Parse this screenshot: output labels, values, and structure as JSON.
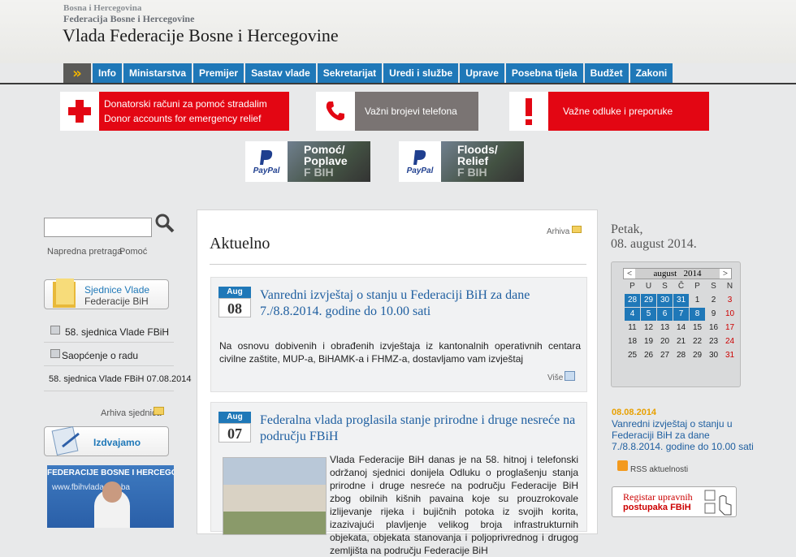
{
  "header": {
    "line1": "Bosna i Hercegovina",
    "line2": "Federacija Bosne i Hercegovine",
    "title": "Vlada Federacije Bosne i Hercegovine"
  },
  "nav": {
    "items": [
      "Info",
      "Ministarstva",
      "Premijer",
      "Sastav vlade",
      "Sekretarijat",
      "Uredi i službe",
      "Uprave",
      "Posebna tijela",
      "Budžet",
      "Zakoni"
    ]
  },
  "banners": {
    "donor_line1": "Donatorski računi za pomoć stradalim",
    "donor_line2": "Donor accounts for emergency relief",
    "phones": "Važni brojevi telefona",
    "decisions": "Važne odluke i preporuke"
  },
  "paypal": {
    "logo": "PayPal",
    "p1_line1": "Pomoć/",
    "p1_line2": "Poplave",
    "p1_line3": "F BIH",
    "p2_line1": "Floods/",
    "p2_line2": "Relief",
    "p2_line3": "F BIH"
  },
  "sidebar": {
    "advanced_search": "Napredna pretraga",
    "help": "Pomoć",
    "sessions_line1": "Sjednice Vlade",
    "sessions_line2": "Federacije BiH",
    "session_link": "58. sjednica Vlade FBiH",
    "statement_link": "Saopćenje o radu",
    "session_date": "58. sjednica Vlade FBiH 07.08.2014",
    "archive_sessions": "Arhiva sjednica",
    "featured": "Izdvajamo",
    "tv_banner": "FEDERACIJE BOSNE I HERCEGO",
    "tv_url": "www.fbihvlada.gov.ba"
  },
  "main": {
    "title": "Aktuelno",
    "archive": "Arhiva",
    "articles": [
      {
        "month": "Aug",
        "day": "08",
        "title": "Vanredni izvještaj o stanju u Federaciji BiH za dane 7./8.8.2014. godine do 10.00 sati",
        "body": "Na osnovu dobivenih i obrađenih izvještaja iz kantonalnih operativnih centara civilne zaštite, MUP-a, BiHAMK-a i FHMZ-a, dostavljamo vam izvještaj",
        "more": "Više"
      },
      {
        "month": "Aug",
        "day": "07",
        "title": "Federalna vlada proglasila stanje prirodne i druge nesreće na području FBiH",
        "body": "Vlada Federacije BiH danas je na 58. hitnoj i telefonski održanoj sjednici donijela Odluku o proglašenju stanja prirodne i druge nesreće na području Federacije BiH zbog obilnih kišnih pavaina koje su prouzrokovale izlijevanje rijeka i bujičnih potoka iz svojih korita, izazivajući plavljenje velikog broja infrastrukturnih objekata, objekata stanovanja i poljoprivrednog i drugog zemljišta na području Federacije BiH"
      }
    ]
  },
  "right": {
    "weekday": "Petak,",
    "date": "08. august 2014.",
    "calendar": {
      "prev": "<",
      "next": ">",
      "month_year": "august   2014",
      "days_header": [
        "P",
        "U",
        "S",
        "Č",
        "P",
        "S",
        "N"
      ],
      "rows": [
        [
          "28",
          "29",
          "30",
          "31",
          "1",
          "2",
          "3"
        ],
        [
          "4",
          "5",
          "6",
          "7",
          "8",
          "9",
          "10"
        ],
        [
          "11",
          "12",
          "13",
          "14",
          "15",
          "16",
          "17"
        ],
        [
          "18",
          "19",
          "20",
          "21",
          "22",
          "23",
          "24"
        ],
        [
          "25",
          "26",
          "27",
          "28",
          "29",
          "30",
          "31"
        ]
      ]
    },
    "news_date": "08.08.2014",
    "news_text": "Vanredni izvještaj o stanju u Federaciji BiH za dane 7./8.8.2014. godine do 10.00 sati",
    "rss": "RSS aktuelnosti",
    "registry_line1": "Registar upravnih",
    "registry_line2": "postupaka FBiH"
  },
  "colors": {
    "nav_blue": "#1f78b8",
    "red": "#e30613",
    "title_blue": "#1f5fa0",
    "orange": "#e8a000"
  }
}
